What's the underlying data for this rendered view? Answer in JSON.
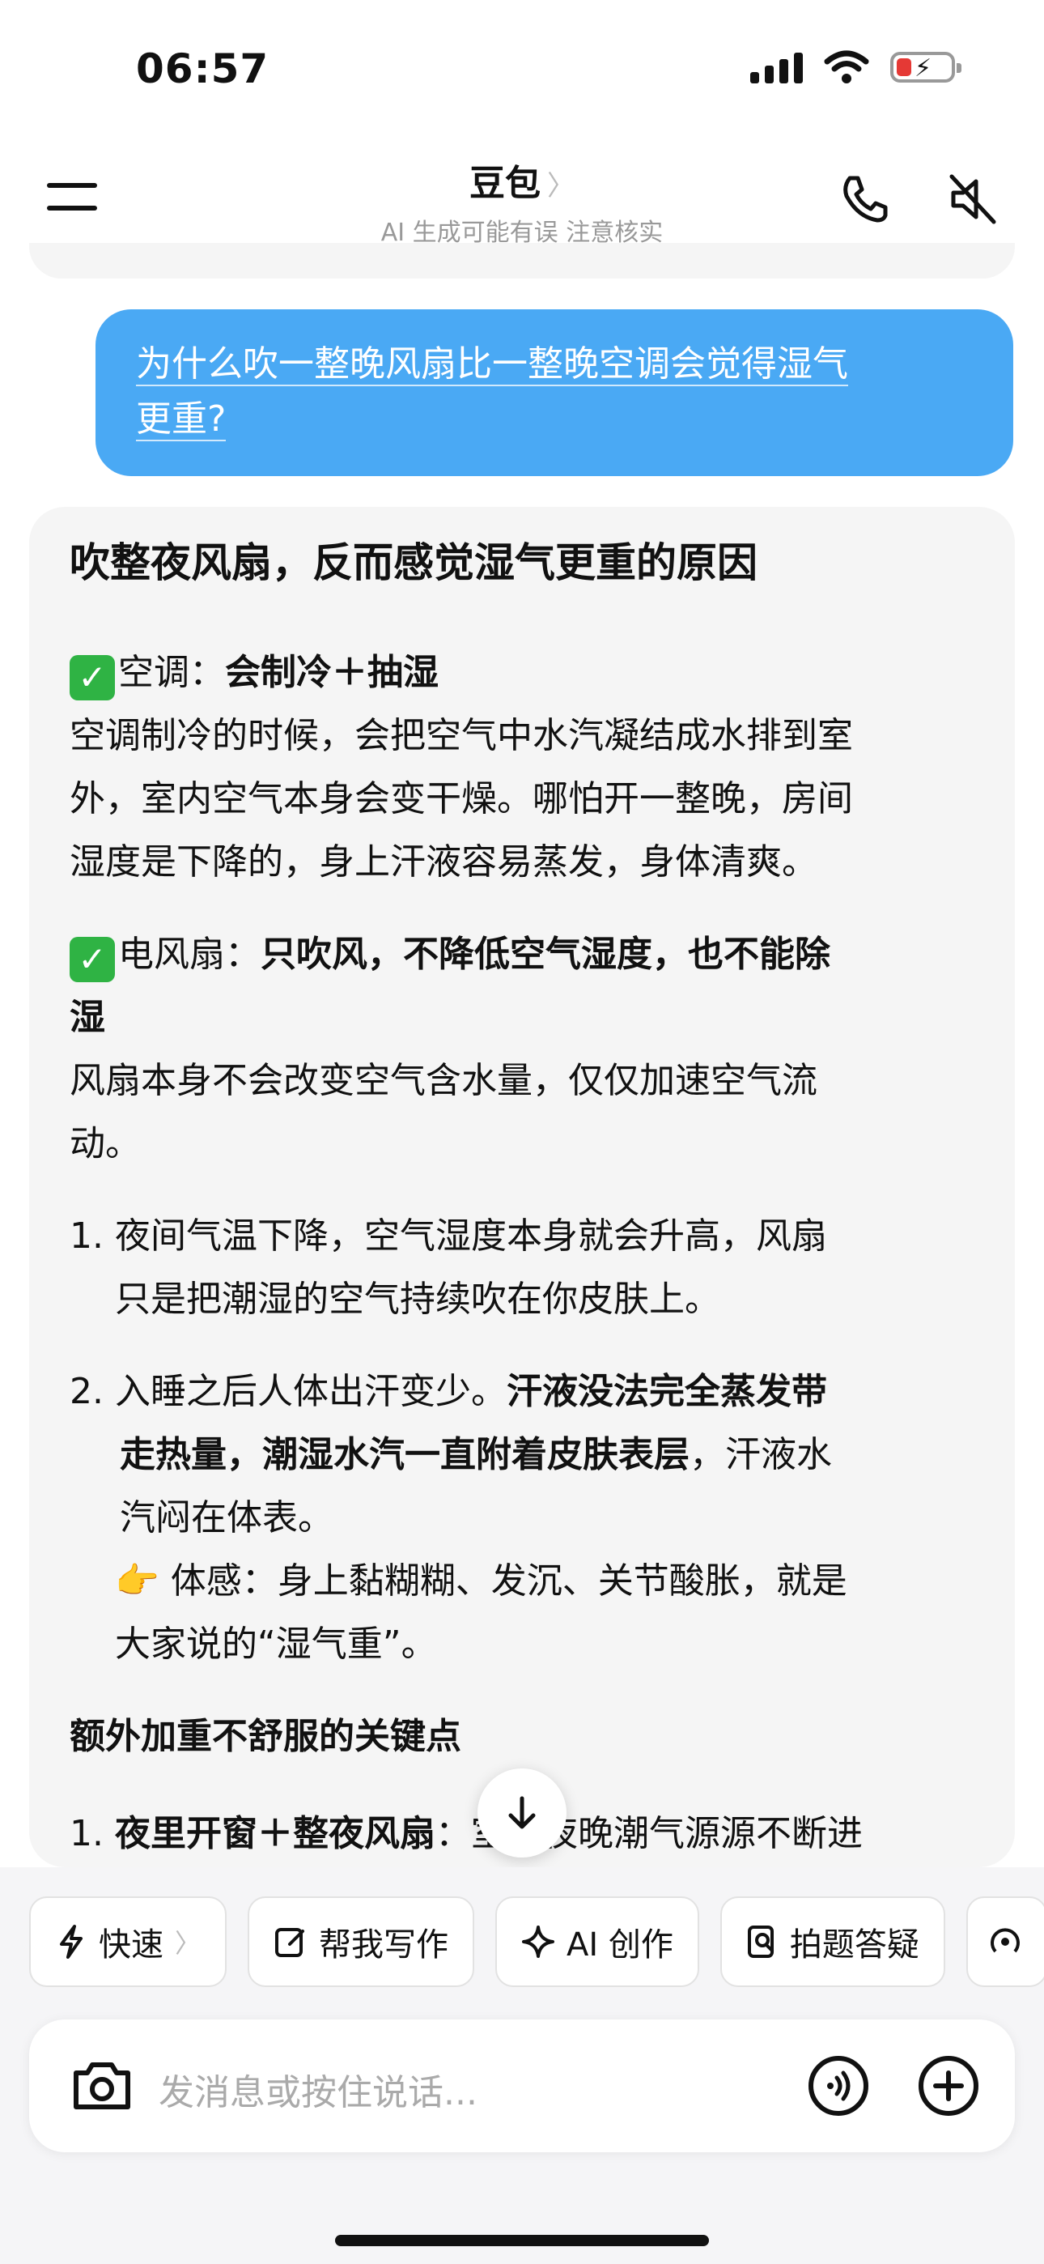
{
  "status_bar": {
    "time": "06:57"
  },
  "header": {
    "title": "豆包",
    "title_chevron": "〉",
    "subtitle": "AI 生成可能有误 注意核实"
  },
  "user_message": {
    "line1": "为什么吹一整晚风扇比一整晚空调会觉得湿气",
    "line2": "更重?"
  },
  "answer": {
    "heading": "吹整夜风扇，反而感觉湿气更重的原因",
    "check_mark": "✓",
    "ac": {
      "label": "空调：",
      "bold": "会制冷＋抽湿",
      "lines": [
        "空调制冷的时候，会把空气中水汽凝结成水排到室",
        "外，室内空气本身会变干燥。哪怕开一整晚，房间",
        "湿度是下降的，身上汗液容易蒸发，身体清爽。"
      ]
    },
    "fan": {
      "label": "电风扇：",
      "bold_line1": "只吹风，不降低空气湿度，也不能除",
      "bold_line2": "湿",
      "lines": [
        "风扇本身不会改变空气含水量，仅仅加速空气流",
        "动。"
      ]
    },
    "list": [
      {
        "num": "1.",
        "line1": "夜间气温下降，空气湿度本身就会升高，风扇",
        "line2": "只是把潮湿的空气持续吹在你皮肤上。"
      },
      {
        "num": "2.",
        "line1_plain": "入睡之后人体出汗变少。",
        "line1_bold": "汗液没法完全蒸发带",
        "line2_bold": "走热量，潮湿水汽一直附着皮肤表层",
        "line2_plain": "，汗液水",
        "line3": "汽闷在体表。"
      }
    ],
    "feel_emoji": "👉",
    "feel_line1": "体感：身上黏糊糊、发沉、关节酸胀，就是",
    "feel_line2": "大家说的“湿气重”。",
    "extra_heading": "额外加重不舒服的关键点",
    "extra_item": {
      "num": "1.",
      "bold": "夜里开窗＋整夜风扇",
      "plain": "：室外夜晚潮气源源不断进"
    }
  },
  "chips": [
    {
      "label": "快速",
      "icon": "lightning-icon",
      "chevron": "〉"
    },
    {
      "label": "帮我写作",
      "icon": "edit-icon"
    },
    {
      "label": "AI 创作",
      "icon": "sparkle-icon"
    },
    {
      "label": "拍题答疑",
      "icon": "scan-question-icon"
    }
  ],
  "input": {
    "placeholder": "发消息或按住说话..."
  },
  "colors": {
    "user_bubble": "#4aa9f4",
    "answer_bg": "#f5f5f5",
    "check": "#2fb344",
    "battery_low": "#e53935"
  }
}
